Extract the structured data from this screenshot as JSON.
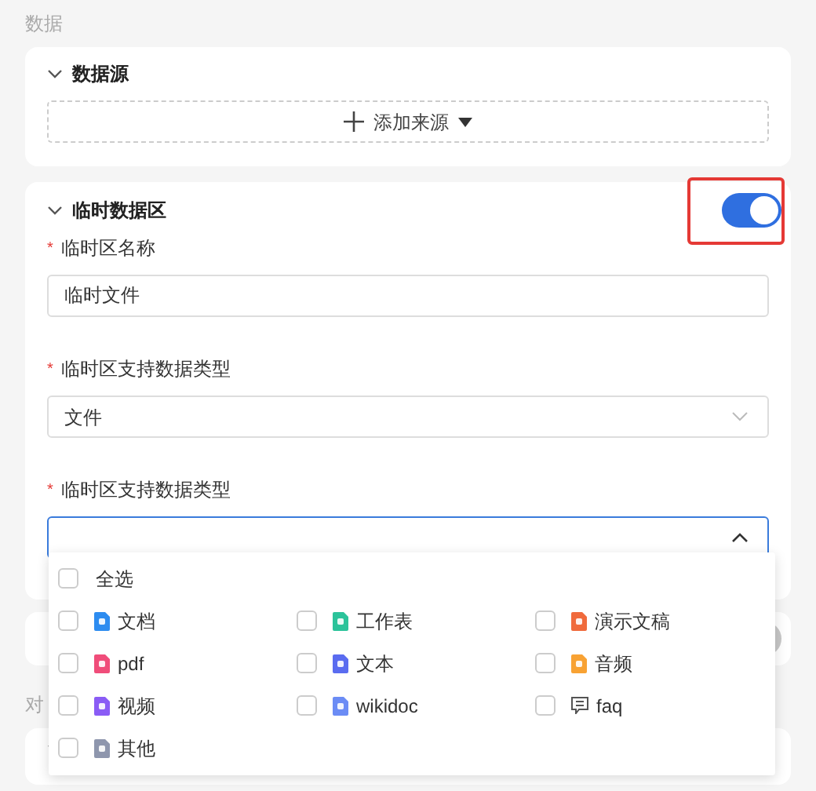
{
  "section_label": "数据",
  "data_source": {
    "title": "数据源",
    "expanded": true,
    "add_button": "添加来源"
  },
  "temp_zone": {
    "title": "临时数据区",
    "expanded": true,
    "enabled": true,
    "highlighted": true,
    "fields": [
      {
        "kind": "input",
        "label": "临时区名称",
        "required_mark": "*",
        "value": "临时文件"
      },
      {
        "kind": "select",
        "label": "临时区支持数据类型",
        "required_mark": "*",
        "value": "文件",
        "open": false
      },
      {
        "kind": "select",
        "label": "临时区支持数据类型",
        "required_mark": "*",
        "open": true
      }
    ]
  },
  "hidden_card": {
    "enabled": false
  },
  "section_label_2": "对",
  "last_card": {
    "expanded": true
  },
  "dropdown": {
    "select_all": {
      "label": "全选",
      "checked": false
    },
    "options": [
      {
        "label": "文档",
        "checked": false,
        "kind": "file",
        "color": "#2d8cf0"
      },
      {
        "label": "工作表",
        "checked": false,
        "kind": "file",
        "color": "#2bc39a"
      },
      {
        "label": "演示文稿",
        "checked": false,
        "kind": "file",
        "color": "#f06a3c"
      },
      {
        "label": "pdf",
        "checked": false,
        "kind": "file",
        "color": "#f04d7a"
      },
      {
        "label": "文本",
        "checked": false,
        "kind": "file",
        "color": "#5a6cf0"
      },
      {
        "label": "音频",
        "checked": false,
        "kind": "file",
        "color": "#f8a233"
      },
      {
        "label": "视频",
        "checked": false,
        "kind": "file",
        "color": "#8a5cf5"
      },
      {
        "label": "wikidoc",
        "checked": false,
        "kind": "file",
        "color": "#6b8cf5"
      },
      {
        "label": "faq",
        "checked": false,
        "kind": "chat"
      },
      {
        "label": "其他",
        "checked": false,
        "kind": "file",
        "color": "#8e96ad"
      }
    ]
  }
}
